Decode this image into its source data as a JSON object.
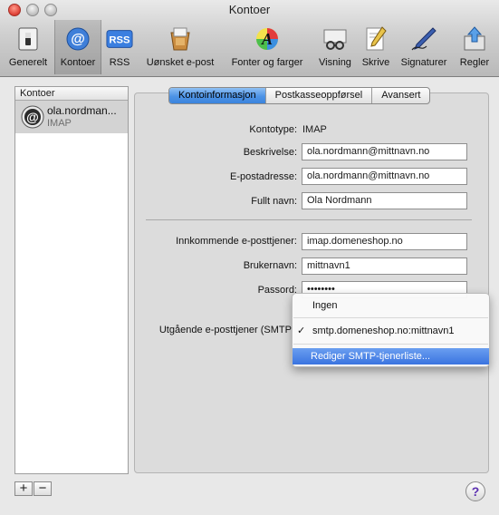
{
  "window": {
    "title": "Kontoer"
  },
  "toolbar": {
    "items": [
      {
        "label": "Generelt",
        "icon": "switch-icon"
      },
      {
        "label": "Kontoer",
        "icon": "at-sign-icon",
        "selected": true
      },
      {
        "label": "RSS",
        "icon": "rss-icon"
      },
      {
        "label": "Uønsket e-post",
        "icon": "junk-mail-icon"
      },
      {
        "label": "Fonter og farger",
        "icon": "color-font-icon"
      },
      {
        "label": "Visning",
        "icon": "viewing-icon"
      },
      {
        "label": "Skrive",
        "icon": "compose-icon"
      },
      {
        "label": "Signaturer",
        "icon": "signature-pen-icon"
      },
      {
        "label": "Regler",
        "icon": "rules-icon"
      }
    ]
  },
  "sidebar": {
    "header": "Kontoer",
    "account": {
      "name": "ola.nordman...",
      "type": "IMAP"
    },
    "add_label": "+",
    "remove_label": "−"
  },
  "tabs": [
    {
      "label": "Kontoinformasjon",
      "selected": true
    },
    {
      "label": "Postkasseoppførsel"
    },
    {
      "label": "Avansert"
    }
  ],
  "form": {
    "kontotype_label": "Kontotype:",
    "kontotype_value": "IMAP",
    "beskrivelse_label": "Beskrivelse:",
    "beskrivelse_value": "ola.nordmann@mittnavn.no",
    "epost_label": "E-postadresse:",
    "epost_value": "ola.nordmann@mittnavn.no",
    "navn_label": "Fullt navn:",
    "navn_value": "Ola Nordmann",
    "inn_label": "Innkommende e-posttjener:",
    "inn_value": "imap.domeneshop.no",
    "bruker_label": "Brukernavn:",
    "bruker_value": "mittnavn1",
    "passord_label": "Passord:",
    "passord_value": "••••••••",
    "smtp_label": "Utgående e-posttjener (SMTP"
  },
  "smtp_menu": {
    "items": [
      {
        "label": "Ingen"
      },
      {
        "label": "smtp.domeneshop.no:mittnavn1",
        "checked": true,
        "check": "✓"
      },
      {
        "label": "Rediger SMTP-tjenerliste...",
        "highlighted": true
      }
    ]
  },
  "help": {
    "label": "?"
  },
  "colors": {
    "selection": "#3a74e0",
    "tab_selected": "#4d93e6"
  }
}
